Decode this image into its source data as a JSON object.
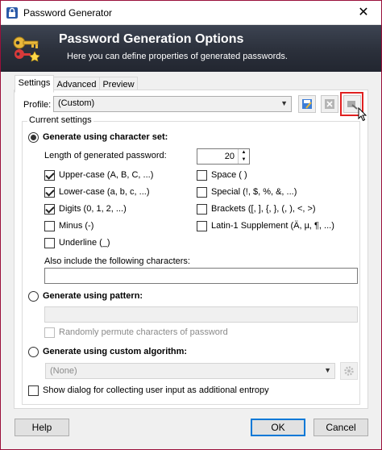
{
  "window": {
    "title": "Password Generator",
    "close_glyph": "✕"
  },
  "banner": {
    "title": "Password Generation Options",
    "subtitle": "Here you can define properties of generated passwords."
  },
  "tabs": [
    {
      "label": "Settings",
      "active": true
    },
    {
      "label": "Advanced",
      "active": false
    },
    {
      "label": "Preview",
      "active": false
    }
  ],
  "profile": {
    "label": "Profile:",
    "value": "(Custom)"
  },
  "current_settings": {
    "legend": "Current settings",
    "charset": {
      "label": "Generate using character set:",
      "selected": true,
      "length_label": "Length of generated password:",
      "length_value": "20",
      "options_left": [
        {
          "label": "Upper-case (A, B, C, ...)",
          "checked": true
        },
        {
          "label": "Lower-case (a, b, c, ...)",
          "checked": true
        },
        {
          "label": "Digits (0, 1, 2, ...)",
          "checked": true
        },
        {
          "label": "Minus (-)",
          "checked": false
        },
        {
          "label": "Underline (_)",
          "checked": false
        }
      ],
      "options_right": [
        {
          "label": "Space ( )",
          "checked": false
        },
        {
          "label": "Special (!, $, %, &, ...)",
          "checked": false
        },
        {
          "label": "Brackets ([, ], {, }, (, ), <, >)",
          "checked": false
        },
        {
          "label": "Latin-1 Supplement (Ä, µ, ¶, ...)",
          "checked": false
        }
      ],
      "include_label": "Also include the following characters:",
      "include_value": ""
    },
    "pattern": {
      "label": "Generate using pattern:",
      "selected": false,
      "value": "",
      "permute_label": "Randomly permute characters of password",
      "permute_checked": false
    },
    "algorithm": {
      "label": "Generate using custom algorithm:",
      "selected": false,
      "value": "(None)"
    }
  },
  "entropy": {
    "label": "Show dialog for collecting user input as additional entropy",
    "checked": false
  },
  "buttons": {
    "help": "Help",
    "ok": "OK",
    "cancel": "Cancel"
  },
  "colors": {
    "window_border": "#9a0f3a",
    "highlight": "#e02020",
    "default_button": "#0078d7"
  }
}
